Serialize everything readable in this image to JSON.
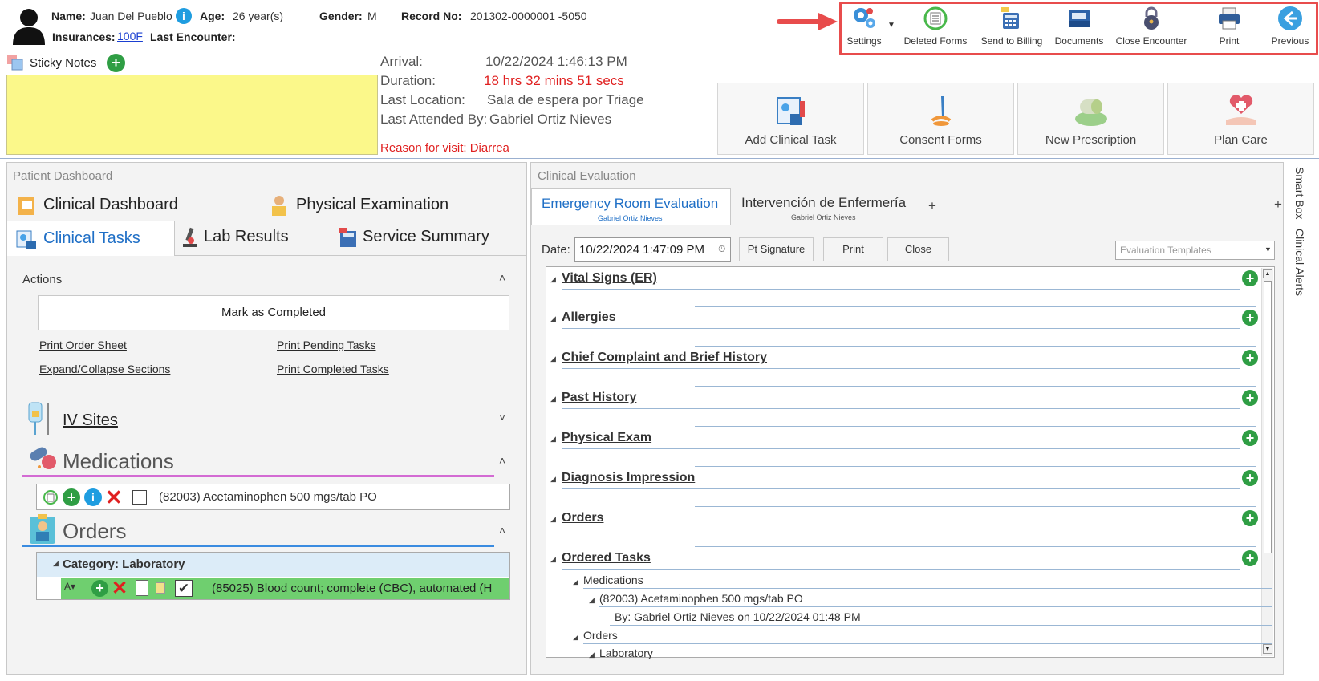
{
  "header": {
    "name_label": "Name:",
    "name_value": "Juan Del Pueblo",
    "age_label": "Age:",
    "age_value": "26 year(s)",
    "gender_label": "Gender:",
    "gender_value": "M",
    "record_label": "Record No:",
    "record_value": "201302-0000001 -5050",
    "insurances_label": "Insurances:",
    "insurances_value": "100F",
    "last_encounter_label": "Last Encounter:"
  },
  "toolbar": {
    "highlight_color": "#e84c4c",
    "items": [
      {
        "label": "Settings",
        "icon": "gears-icon"
      },
      {
        "label": "Deleted Forms",
        "icon": "restore-document-icon"
      },
      {
        "label": "Send to Billing",
        "icon": "billing-calculator-icon"
      },
      {
        "label": "Documents",
        "icon": "inbox-tray-icon"
      },
      {
        "label": "Close Encounter",
        "icon": "padlock-icon"
      },
      {
        "label": "Print",
        "icon": "printer-icon"
      },
      {
        "label": "Previous",
        "icon": "back-arrow-icon"
      }
    ]
  },
  "sticky": {
    "label": "Sticky Notes",
    "color": "#fbf88a"
  },
  "visit": {
    "arrival_label": "Arrival:",
    "arrival_value": "10/22/2024 1:46:13 PM",
    "duration_label": "Duration:",
    "duration_value": "18 hrs 32 mins 51 secs",
    "location_label": "Last Location:",
    "location_value": "Sala de espera por Triage",
    "attended_label": "Last Attended By:",
    "attended_value": "Gabriel Ortiz Nieves",
    "reason": "Reason for visit: Diarrea",
    "alert_color": "#e02020"
  },
  "quick_actions": [
    {
      "label": "Add Clinical Task",
      "icon": "clinical-task-icon"
    },
    {
      "label": "Consent Forms",
      "icon": "signing-pen-icon"
    },
    {
      "label": "New Prescription",
      "icon": "pill-icon"
    },
    {
      "label": "Plan Care",
      "icon": "heart-hand-icon"
    }
  ],
  "patient_dashboard": {
    "title": "Patient Dashboard",
    "tabs": [
      {
        "label": "Clinical Dashboard"
      },
      {
        "label": "Physical Examination"
      },
      {
        "label": "Clinical Tasks"
      },
      {
        "label": "Lab Results"
      },
      {
        "label": "Service Summary"
      }
    ],
    "active_tab": "Clinical Tasks",
    "actions_title": "Actions",
    "mark_completed": "Mark as Completed",
    "links": {
      "print_order_sheet": "Print Order Sheet",
      "print_pending_tasks": "Print Pending Tasks",
      "expand_collapse": "Expand/Collapse Sections",
      "print_completed_tasks": "Print Completed Tasks"
    },
    "iv_sites": "IV Sites",
    "medications": {
      "title": "Medications",
      "accent": "#d36bd3",
      "item": "(82003) Acetaminophen 500 mgs/tab PO"
    },
    "orders": {
      "title": "Orders",
      "accent": "#3a8be0",
      "category": "Category: Laboratory",
      "item": "(85025) Blood count; complete (CBC), automated (H",
      "row_color": "#6fcf6f"
    }
  },
  "clinical_evaluation": {
    "title": "Clinical Evaluation",
    "tabs": [
      {
        "label": "Emergency Room Evaluation",
        "sub": "Gabriel Ortiz Nieves"
      },
      {
        "label": "Intervención de Enfermería",
        "sub": "Gabriel Ortiz Nieves"
      }
    ],
    "add_tab": "+",
    "add_tab_right": "+",
    "date_label": "Date:",
    "date_value": "10/22/2024 1:47:09 PM",
    "pt_signature": "Pt Signature",
    "print": "Print",
    "close": "Close",
    "templates_placeholder": "Evaluation Templates",
    "sections": [
      {
        "label": "Vital Signs (ER)"
      },
      {
        "label": "Allergies"
      },
      {
        "label": "Chief Complaint and Brief History"
      },
      {
        "label": "Past History"
      },
      {
        "label": "Physical Exam"
      },
      {
        "label": "Diagnosis Impression"
      },
      {
        "label": "Orders"
      },
      {
        "label": "Ordered Tasks"
      }
    ],
    "ordered_tasks": {
      "medications": "Medications",
      "med_item": "(82003) Acetaminophen 500 mgs/tab PO",
      "med_by": "By: Gabriel Ortiz Nieves on 10/22/2024 01:48 PM",
      "orders": "Orders",
      "laboratory": "Laboratory"
    }
  },
  "side_tabs": {
    "smart_box": "Smart Box",
    "clinical_alerts": "Clinical Alerts"
  }
}
